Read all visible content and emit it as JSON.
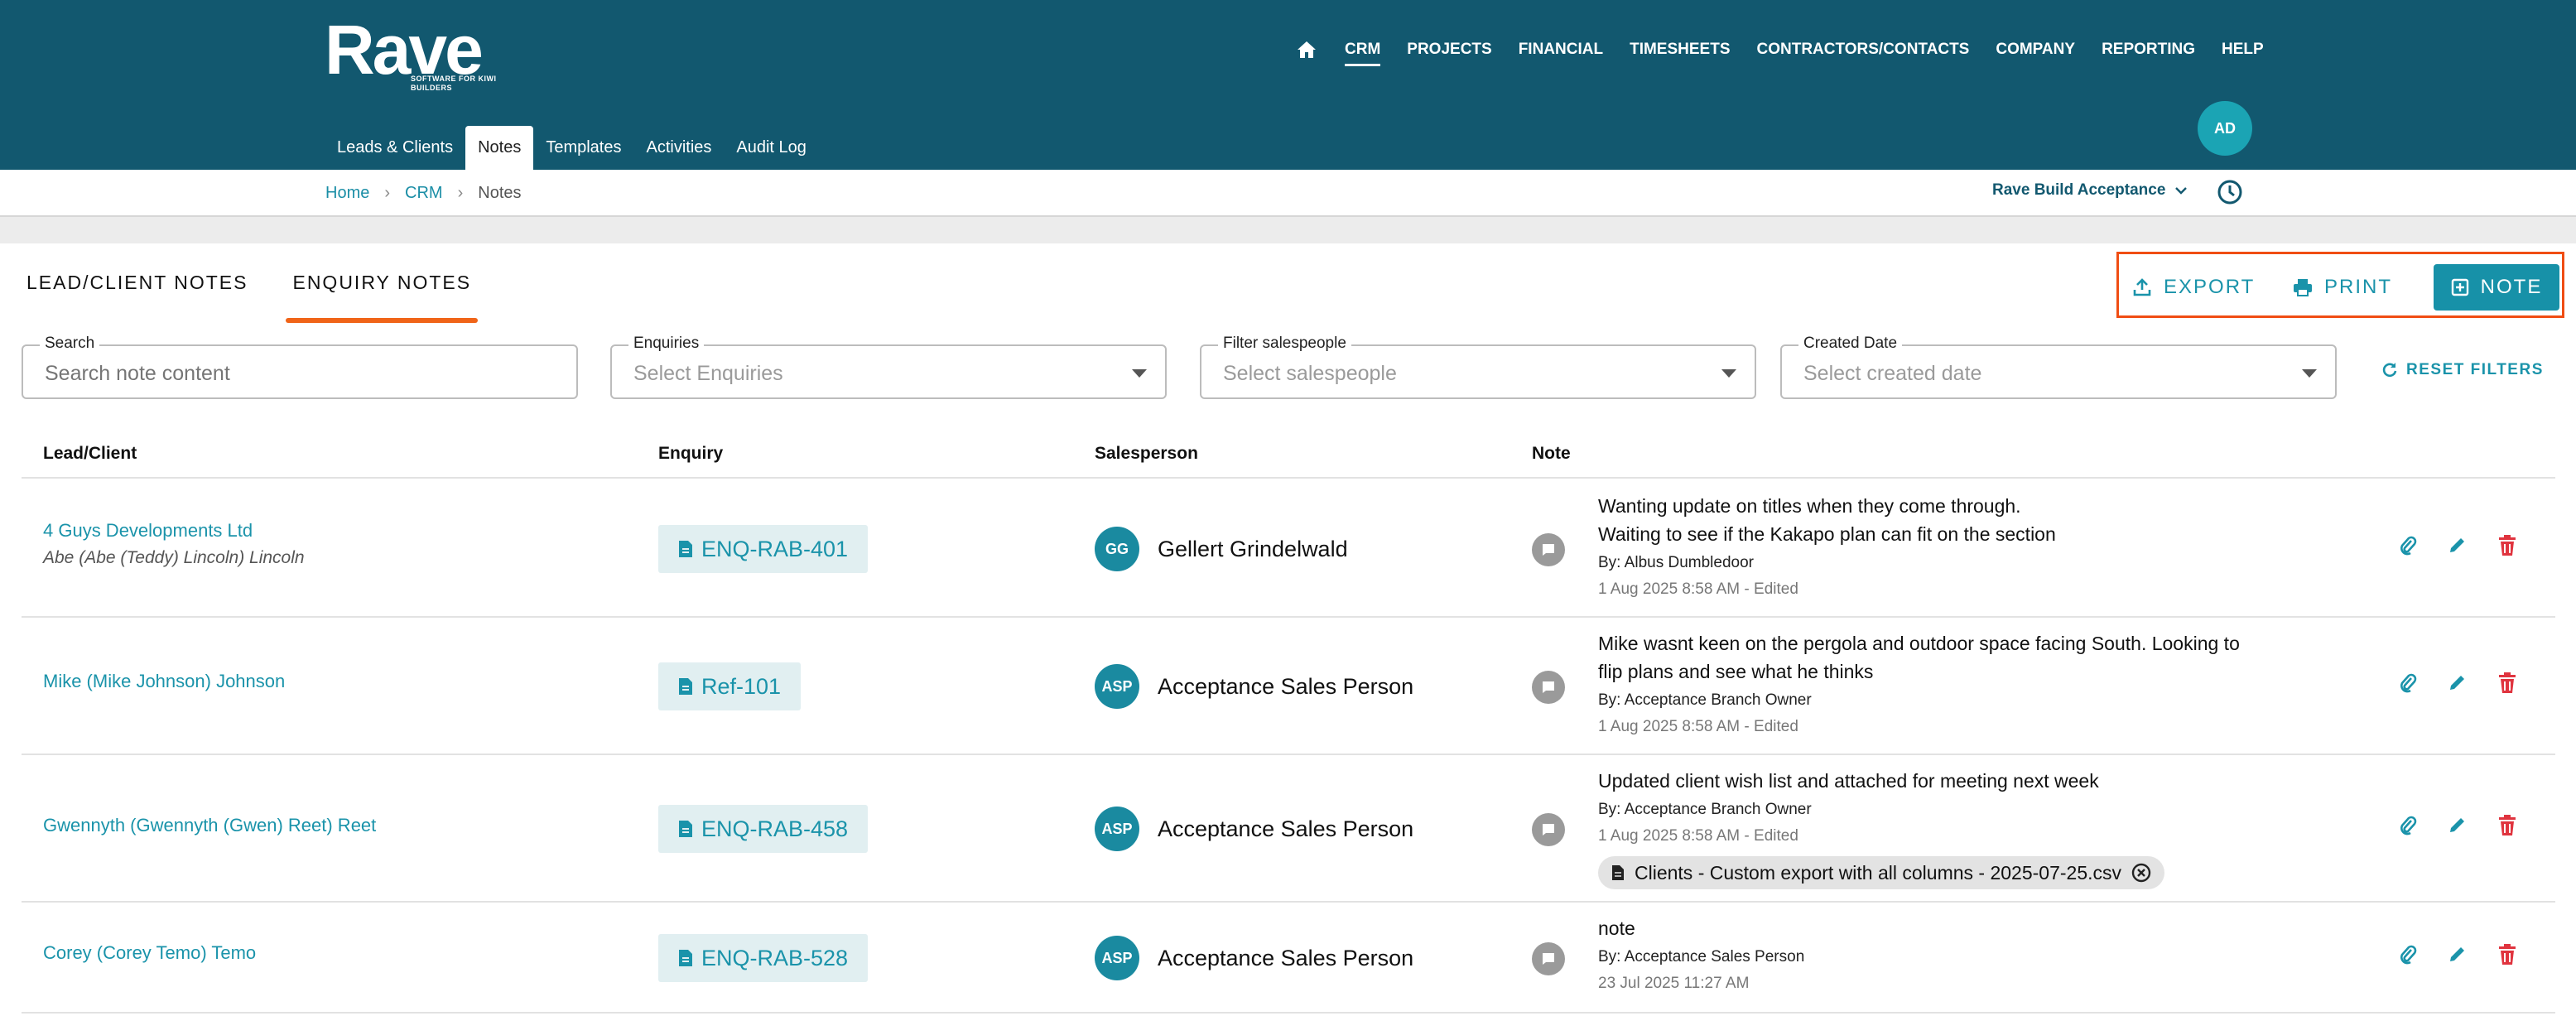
{
  "brand": {
    "logo_text": "Rave",
    "tagline": "SOFTWARE FOR KIWI BUILDERS"
  },
  "topnav": {
    "items": [
      "CRM",
      "PROJECTS",
      "FINANCIAL",
      "TIMESHEETS",
      "CONTRACTORS/CONTACTS",
      "COMPANY",
      "REPORTING",
      "HELP"
    ],
    "active": "CRM"
  },
  "subnav": {
    "items": [
      "Leads & Clients",
      "Notes",
      "Templates",
      "Activities",
      "Audit Log"
    ],
    "active": "Notes"
  },
  "user": {
    "initials": "AD"
  },
  "breadcrumb": {
    "home": "Home",
    "crm": "CRM",
    "current": "Notes"
  },
  "branch_selector": {
    "label": "Rave Build Acceptance"
  },
  "tabs": {
    "lead_client": "LEAD/CLIENT NOTES",
    "enquiry": "ENQUIRY NOTES",
    "active": "ENQUIRY NOTES"
  },
  "actions": {
    "export": "EXPORT",
    "print": "PRINT",
    "note": "NOTE"
  },
  "filters": {
    "search": {
      "label": "Search",
      "placeholder": "Search note content"
    },
    "enquiries": {
      "label": "Enquiries",
      "placeholder": "Select Enquiries"
    },
    "salespeople": {
      "label": "Filter salespeople",
      "placeholder": "Select salespeople"
    },
    "created_date": {
      "label": "Created Date",
      "placeholder": "Select created date"
    },
    "reset": "RESET FILTERS"
  },
  "table": {
    "columns": {
      "client": "Lead/Client",
      "enquiry": "Enquiry",
      "salesperson": "Salesperson",
      "note": "Note"
    },
    "rows": [
      {
        "client": "4 Guys Developments Ltd",
        "client_sub": "Abe (Abe (Teddy) Lincoln) Lincoln",
        "enquiry": "ENQ-RAB-401",
        "sp_initials": "GG",
        "salesperson": "Gellert Grindelwald",
        "note_lines": [
          "Wanting update on titles when they come through.",
          "Waiting to see if the Kakapo plan can fit on the section"
        ],
        "by": "By: Albus Dumbledoor",
        "date": "1 Aug 2025 8:58 AM - Edited"
      },
      {
        "client": "Mike (Mike Johnson) Johnson",
        "client_sub": "",
        "enquiry": "Ref-101",
        "sp_initials": "ASP",
        "salesperson": "Acceptance Sales Person",
        "note_lines": [
          "Mike wasnt keen on the pergola and outdoor space facing South. Looking to",
          "flip plans and see what he thinks"
        ],
        "by": "By: Acceptance Branch Owner",
        "date": "1 Aug 2025 8:58 AM - Edited"
      },
      {
        "client": "Gwennyth (Gwennyth (Gwen) Reet) Reet",
        "client_sub": "",
        "enquiry": "ENQ-RAB-458",
        "sp_initials": "ASP",
        "salesperson": "Acceptance Sales Person",
        "note_lines": [
          "Updated client wish list and attached for meeting next week"
        ],
        "by": "By: Acceptance Branch Owner",
        "date": "1 Aug 2025 8:58 AM - Edited",
        "attachment": "Clients - Custom export with all columns - 2025-07-25.csv"
      },
      {
        "client": "Corey (Corey Temo) Temo",
        "client_sub": "",
        "enquiry": "ENQ-RAB-528",
        "sp_initials": "ASP",
        "salesperson": "Acceptance Sales Person",
        "note_lines": [
          "note"
        ],
        "by": "By: Acceptance Sales Person",
        "date": "23 Jul 2025 11:27 AM"
      }
    ]
  },
  "colors": {
    "header_bg": "#12586f",
    "accent": "#1a93aa",
    "tab_indicator": "#f06418",
    "highlight_box": "#f04d13",
    "delete": "#e0343f"
  },
  "icons": [
    "home-icon",
    "chevron-down-icon",
    "clock-icon",
    "export-icon",
    "print-icon",
    "add-note-icon",
    "refresh-icon",
    "document-icon",
    "comment-icon",
    "paperclip-icon",
    "pencil-icon",
    "trash-icon",
    "file-icon",
    "close-circle-icon"
  ]
}
